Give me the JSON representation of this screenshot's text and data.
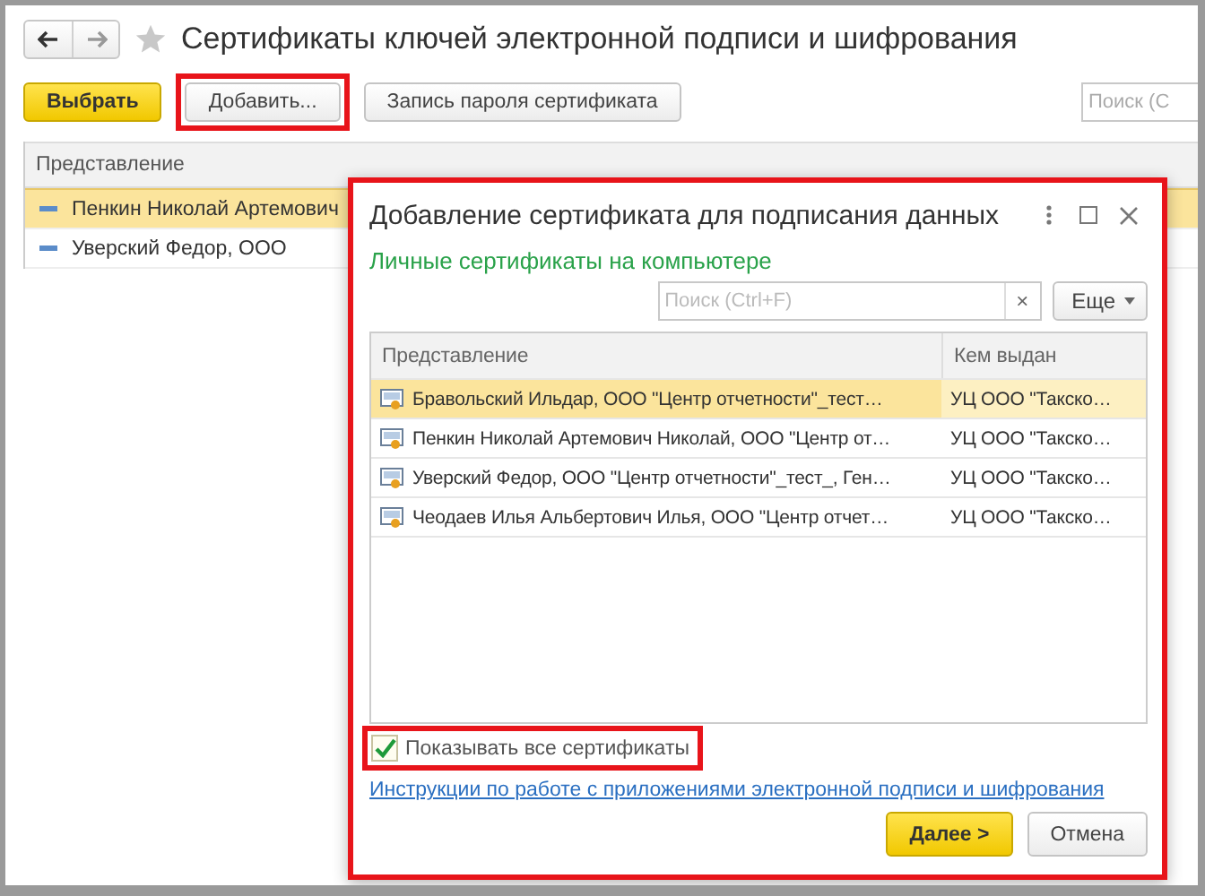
{
  "window": {
    "title": "Сертификаты ключей электронной подписи и шифрования"
  },
  "toolbar": {
    "buttons": [
      {
        "label": "Выбрать",
        "kind": "primary",
        "highlighted": false
      },
      {
        "label": "Добавить...",
        "kind": "normal",
        "highlighted": true
      },
      {
        "label": "Запись пароля сертификата",
        "kind": "normal",
        "highlighted": false
      }
    ],
    "search": {
      "placeholder": "Поиск (С"
    }
  },
  "table": {
    "columns": [
      "Представление"
    ],
    "rows": [
      {
        "text": "Пенкин Николай Артемович",
        "selected": true
      },
      {
        "text": "Уверский Федор, ООО",
        "selected": false
      }
    ]
  },
  "dialog": {
    "title": "Добавление сертификата для подписания данных",
    "subtitle": "Личные сертификаты на компьютере",
    "search": {
      "placeholder": "Поиск (Ctrl+F)",
      "clear": "×"
    },
    "more_button": "Еще",
    "columns": [
      "Представление",
      "Кем выдан"
    ],
    "rows": [
      {
        "name": "Бравольский Ильдар, ООО \"Центр отчетности\"_тест…",
        "issuer": "УЦ ООО \"Такско…",
        "selected": true
      },
      {
        "name": "Пенкин Николай Артемович Николай, ООО \"Центр от…",
        "issuer": "УЦ ООО \"Такско…",
        "selected": false
      },
      {
        "name": "Уверский Федор, ООО \"Центр отчетности\"_тест_, Ген…",
        "issuer": "УЦ ООО \"Такско…",
        "selected": false
      },
      {
        "name": "Чеодаев Илья Альбертович Илья, ООО \"Центр отчет…",
        "issuer": "УЦ ООО \"Такско…",
        "selected": false
      }
    ],
    "checkbox": {
      "label": "Показывать все сертификаты",
      "checked": true,
      "highlighted": true
    },
    "link": "Инструкции по работе с приложениями электронной подписи и шифрования",
    "buttons": [
      {
        "label": "Далее >",
        "kind": "primary"
      },
      {
        "label": "Отмена",
        "kind": "normal"
      }
    ]
  }
}
